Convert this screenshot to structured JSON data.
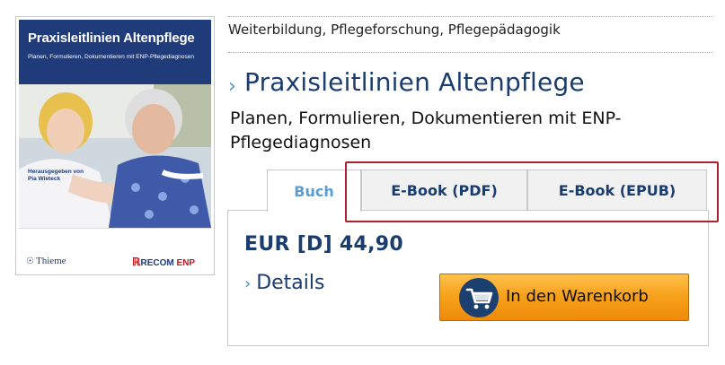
{
  "cover": {
    "title": "Praxisleitlinien Altenpflege",
    "subtitle": "Planen, Formulieren, Dokumentieren mit ENP-Pflegediagnosen",
    "editor_line1": "Herausgegeben von",
    "editor_line2": "Pia Wieteck",
    "publisher": "Thieme",
    "imprint_prefix": "RECOM",
    "imprint_suffix": "ENP"
  },
  "category": "Weiterbildung, Pflegeforschung, Pflegepädagogik",
  "title": "Praxisleitlinien Altenpflege",
  "subtitle": "Planen, Formulieren, Dokumentieren mit ENP-Pflegediagnosen",
  "tabs": [
    {
      "label": "Buch",
      "active": true
    },
    {
      "label": "E-Book (PDF)",
      "active": false
    },
    {
      "label": "E-Book (EPUB)",
      "active": false
    }
  ],
  "price": "EUR [D] 44,90",
  "details_label": "Details",
  "cart_label": "In den Warenkorb",
  "colors": {
    "navy": "#1a3d6e",
    "accent_blue": "#5b9dd0",
    "highlight_red": "#b01f2e",
    "cart_orange": "#f7a21c"
  },
  "icons": [
    "chevron-right-icon",
    "shopping-cart-icon"
  ]
}
